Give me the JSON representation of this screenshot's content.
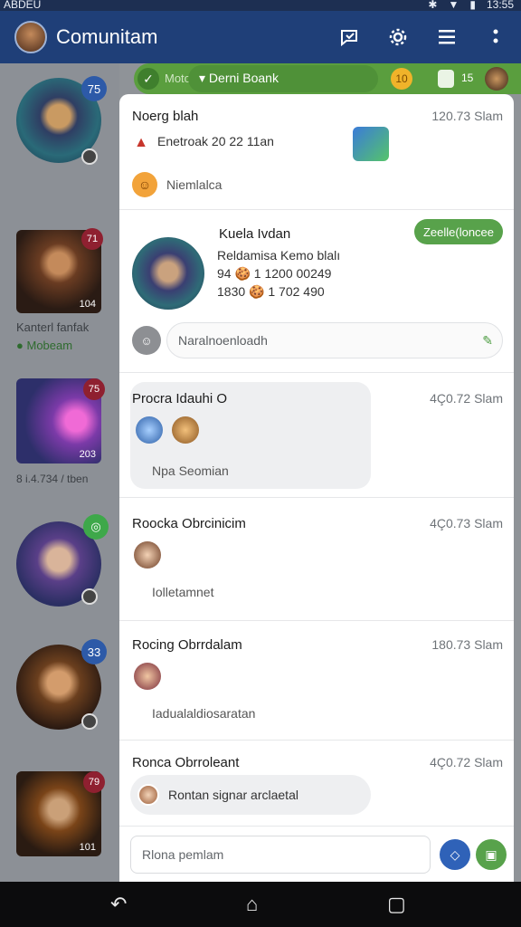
{
  "status_bar": {
    "carrier": "ABDEU",
    "time": "13:55"
  },
  "app_bar": {
    "title": "Comunitam",
    "actions": [
      "chat-check-icon",
      "settings-icon",
      "menu-icon",
      "more-icon"
    ]
  },
  "feed": {
    "items": [
      {
        "badge": "75",
        "badge_color": "#2d5aa8"
      },
      {
        "badge": "71",
        "badge_color": "#8f2030",
        "card_num": "104",
        "caption": "Kanterl fanfak",
        "caption2": "Mobeam"
      },
      {
        "badge": "75",
        "badge_color": "#8f2030",
        "card_num": "203",
        "caption": "8 i.4.734 / tben"
      },
      {
        "badge": "◎",
        "badge_color": "#3ea84a"
      },
      {
        "badge": "33",
        "badge_color": "#2d5aa8"
      },
      {
        "badge": "79",
        "badge_color": "#8f2030",
        "card_num": "101"
      }
    ]
  },
  "banner": {
    "left_text": "Moto",
    "chip": "Derni Boank",
    "coin": "10",
    "count": "15"
  },
  "posts": [
    {
      "name": "Noerg blah",
      "time": "120.73 Slam",
      "line": "Enetroak 20 22 11an",
      "reaction": "Niemlalca"
    },
    {
      "name": "Kuela Ivdan",
      "line1": "Reldamisa Kemo blalı",
      "line2": "94 🍪 1 1200 00249",
      "line3": "1830 🍪 1 702 490",
      "follow": "Zeelle(loncee",
      "reply_placeholder": "Naralnoenloadh"
    },
    {
      "name": "Procra Idauhi O",
      "time": "4Ç0.72 Slam",
      "reply": "Npa Seomian"
    },
    {
      "name": "Roocka Obrcinicim",
      "time": "4Ç0.73 Slam",
      "reply": "Iolletamnet"
    },
    {
      "name": "Rocing Obrrdalam",
      "time": "180.73 Slam",
      "reply": "Iadualaldiosaratan"
    },
    {
      "name": "Ronca Obrroleant",
      "time": "4Ç0.72 Slam",
      "reply": "Rontan signar arclaetal"
    }
  ],
  "composer": {
    "placeholder": "Rlona pemlam"
  },
  "colors": {
    "app_bar": "#1f3f78",
    "accent_green": "#58a24b",
    "accent_blue": "#2f62b8"
  }
}
